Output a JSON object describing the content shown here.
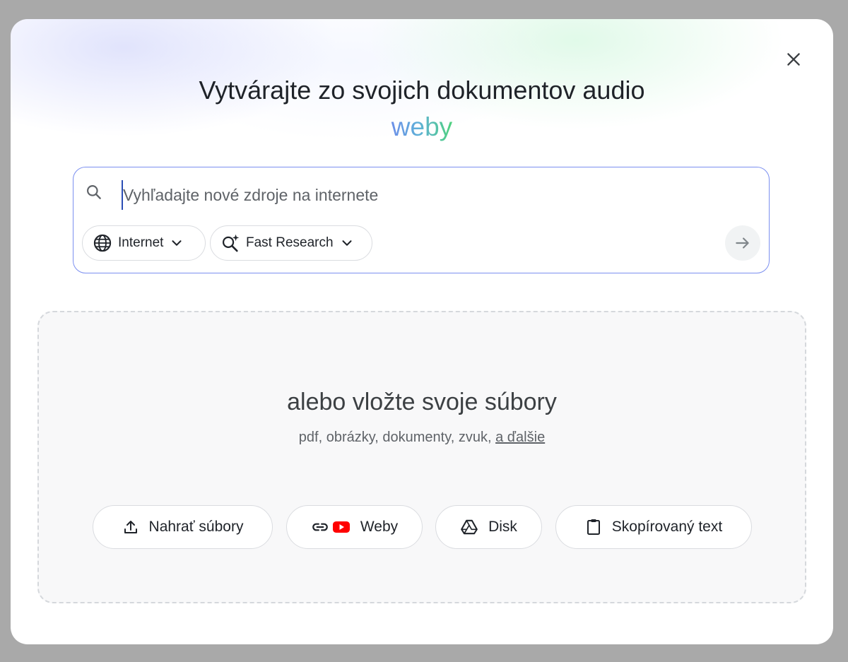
{
  "dialog": {
    "title": "Vytvárajte zo svojich dokumentov audio",
    "title_accent": "weby",
    "close_icon": "close-icon"
  },
  "search": {
    "placeholder": "Vyhľadajte nové zdroje na internete",
    "value": "",
    "source_chip": {
      "label": "Internet",
      "icon": "globe-icon"
    },
    "mode_chip": {
      "label": "Fast Research",
      "icon": "sparkle-search-icon"
    },
    "send_icon": "arrow-right-icon"
  },
  "dropzone": {
    "title": "alebo vložte svoje súbory",
    "subtitle": "pdf, obrázky, dokumenty, zvuk,",
    "more_link": "a ďalšie",
    "buttons": [
      {
        "label": "Nahrať súbory",
        "icon": "upload-icon"
      },
      {
        "label": "Weby",
        "icon": "link-youtube-icon"
      },
      {
        "label": "Disk",
        "icon": "drive-icon"
      },
      {
        "label": "Skopírovaný text",
        "icon": "clipboard-icon"
      }
    ]
  },
  "colors": {
    "accent_border": "#7b8ff0",
    "accent_gradient_start": "#6b8fe8",
    "accent_gradient_end": "#4fd27e",
    "youtube_red": "#ff0000"
  }
}
